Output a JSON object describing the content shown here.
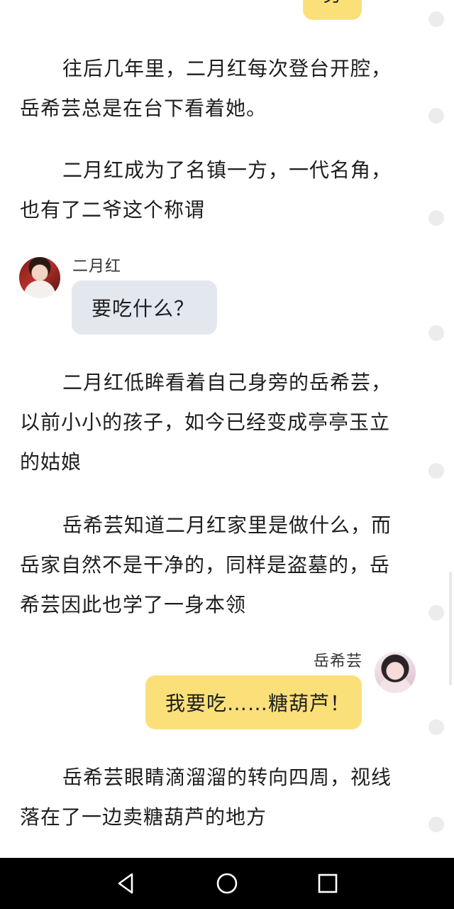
{
  "top_bubble": {
    "text": "劳"
  },
  "paragraphs": [
    "往后几年里，二月红每次登台开腔，岳希芸总是在台下看着她。",
    "二月红成为了名镇一方，一代名角，也有了二爷这个称谓",
    "二月红低眸看着自己身旁的岳希芸，以前小小的孩子，如今已经变成亭亭玉立的姑娘",
    "岳希芸知道二月红家里是做什么，而岳家自然不是干净的，同样是盗墓的，岳希芸因此也学了一身本领",
    "岳希芸眼睛滴溜溜的转向四周，视线落在了一边卖糖葫芦的地方"
  ],
  "messages": [
    {
      "speaker": "二月红",
      "text": "要吃什么？"
    },
    {
      "speaker": "岳希芸",
      "text": "我要吃……糖葫芦！"
    }
  ],
  "nav": {
    "back": "back-icon",
    "home": "home-icon",
    "recents": "recents-icon"
  }
}
